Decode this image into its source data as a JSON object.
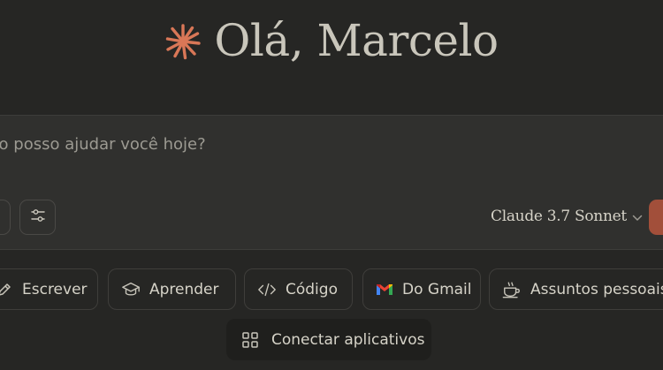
{
  "greeting": {
    "icon": "claude-spark-icon",
    "text": "Olá, Marcelo",
    "accent_color": "#d97757"
  },
  "composer": {
    "placeholder": "mo posso ajudar você hoje?",
    "model": "Claude 3.7 Sonnet",
    "send_button_color": "#a24f3a"
  },
  "actions": [
    {
      "label": "Escrever",
      "icon": "pencil-icon"
    },
    {
      "label": "Aprender",
      "icon": "graduation-cap-icon"
    },
    {
      "label": "Código",
      "icon": "code-icon"
    },
    {
      "label": "Do Gmail",
      "icon": "gmail-icon"
    },
    {
      "label": "Assuntos pessoais",
      "icon": "coffee-cup-icon"
    }
  ],
  "connect": {
    "label": "Conectar aplicativos",
    "icon": "apps-grid-icon"
  }
}
